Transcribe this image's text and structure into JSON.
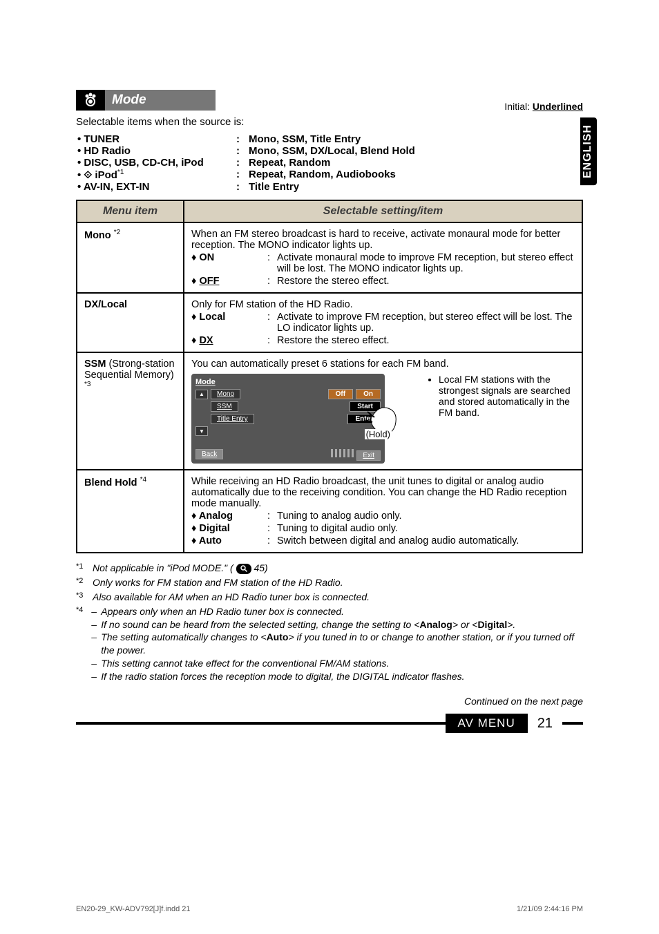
{
  "side_tab": "ENGLISH",
  "mode_title": "Mode",
  "initial_label": "Initial: ",
  "initial_value": "Underlined",
  "intro": "Selectable items when the source is:",
  "sources": [
    {
      "label": "• TUNER",
      "value": "Mono, SSM, Title Entry"
    },
    {
      "label": "• HD Radio",
      "value": "Mono, SSM, DX/Local, Blend Hold"
    },
    {
      "label": "• DISC, USB, CD-CH, iPod",
      "value": "Repeat, Random"
    },
    {
      "label": "•  iPod",
      "sup": "*1",
      "value": "Repeat, Random, Audiobooks",
      "bt": true
    },
    {
      "label": "• AV-IN, EXT-IN",
      "value": "Title Entry"
    }
  ],
  "table": {
    "headers": {
      "menu": "Menu item",
      "setting": "Selectable setting/item"
    },
    "rows": [
      {
        "menu": "Mono",
        "menu_sup": "*2",
        "content": {
          "intro": "When an FM stereo broadcast is hard to receive, activate monaural mode for better reception. The MONO indicator lights up.",
          "options": [
            {
              "label": "♦ ON",
              "desc": "Activate monaural mode to improve FM reception, but stereo effect will be lost. The MONO indicator lights up."
            },
            {
              "label": "♦ OFF",
              "underline": true,
              "desc": "Restore the stereo effect."
            }
          ]
        }
      },
      {
        "menu": "DX/Local",
        "content": {
          "intro": "Only for FM station of the HD Radio.",
          "options": [
            {
              "label": "♦ Local",
              "desc": "Activate to improve FM reception, but stereo effect will be lost. The LO indicator lights up."
            },
            {
              "label": "♦ DX",
              "underline": true,
              "desc": "Restore the stereo effect."
            }
          ]
        }
      },
      {
        "menu": "SSM",
        "menu_light": " (Strong-station Sequential Memory)",
        "menu_sup": "*3",
        "ssm": {
          "intro": "You can automatically preset 6 stations for each FM band.",
          "screen": {
            "title": "Mode",
            "items": [
              "Mono",
              "SSM",
              "Title Entry"
            ],
            "btn_off": "Off",
            "btn_on": "On",
            "btn_start": "Start",
            "btn_enter": "Enter",
            "back": "Back",
            "exit": "Exit"
          },
          "hold": "(Hold)",
          "note": "Local FM stations with the strongest signals are searched and stored automatically in the FM band."
        }
      },
      {
        "menu": "Blend Hold",
        "menu_sup": "*4",
        "content": {
          "intro": "While receiving an HD Radio broadcast, the unit tunes to digital or analog audio automatically due to the receiving condition. You can change the HD Radio reception mode manually.",
          "options": [
            {
              "label": "♦ Analog",
              "desc": "Tuning to analog audio only."
            },
            {
              "label": "♦ Digital",
              "desc": "Tuning to digital audio only."
            },
            {
              "label": "♦ Auto",
              "desc": "Switch between digital and analog audio automatically."
            }
          ]
        }
      }
    ]
  },
  "footnotes": {
    "f1": {
      "mark": "*1",
      "text_pre": "Not applicable in \"iPod MODE.\" (",
      "text_post": " 45)"
    },
    "f2": {
      "mark": "*2",
      "text": "Only works for FM station and FM station of the HD Radio."
    },
    "f3": {
      "mark": "*3",
      "text": "Also available for AM when an HD Radio tuner box is connected."
    },
    "f4": {
      "mark": "*4",
      "lines": [
        "Appears only when an HD Radio tuner box is connected.",
        "If no sound can be heard from the selected setting, change the setting to <Analog> or <Digital>.",
        "The setting automatically changes to <Auto> if you tuned in to or change to another station, or if you turned off the power.",
        "This setting cannot take effect for the conventional FM/AM stations.",
        "If the radio station forces the reception mode to digital, the DIGITAL indicator flashes."
      ]
    }
  },
  "continued": "Continued on the next page",
  "footer_tag": "AV MENU",
  "page_number": "21",
  "bottom_file": "EN20-29_KW-ADV792[J]f.indd   21",
  "bottom_time": "1/21/09   2:44:16 PM"
}
